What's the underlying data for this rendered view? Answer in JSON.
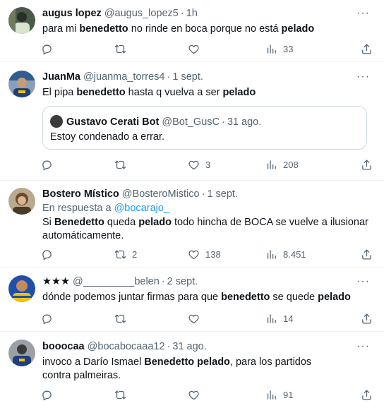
{
  "tweets": [
    {
      "name": "augus lopez",
      "handle": "@augus_lopez5",
      "time": "1h",
      "text_parts": [
        "para mi ",
        "benedetto",
        " no rinde en boca porque no está ",
        "pelado",
        ""
      ],
      "counts": {
        "reply": "",
        "retweet": "",
        "like": "",
        "views": "33"
      }
    },
    {
      "name": "JuanMa",
      "handle": "@juanma_torres4",
      "time": "1 sept.",
      "text_parts": [
        "El pipa ",
        "benedetto",
        " hasta q vuelva a ser ",
        "pelado",
        ""
      ],
      "quote": {
        "name": "Gustavo Cerati Bot",
        "handle": "@Bot_GusC",
        "time": "31 ago.",
        "text": "Estoy condenado a errar."
      },
      "counts": {
        "reply": "",
        "retweet": "",
        "like": "3",
        "views": "208"
      }
    },
    {
      "name": "Bostero Místico",
      "handle": "@BosteroMistico",
      "time": "1 sept.",
      "reply_prefix": "En respuesta a ",
      "reply_handle": "@bocarajo_",
      "text_parts": [
        "Si ",
        "Benedetto",
        " queda ",
        "pelado",
        " todo hincha de BOCA se vuelve a ilusionar automáticamente."
      ],
      "counts": {
        "reply": "",
        "retweet": "2",
        "like": "138",
        "views": "8.451"
      }
    },
    {
      "name": "★★★",
      "handle": "@_________belen",
      "time": "2 sept.",
      "text_parts": [
        "dónde podemos juntar firmas para que ",
        "benedetto",
        " se quede ",
        "pelado",
        ""
      ],
      "counts": {
        "reply": "",
        "retweet": "",
        "like": "",
        "views": "14"
      }
    },
    {
      "name": "booocaa",
      "handle": "@bocabocaaa12",
      "time": "31 ago.",
      "text_parts": [
        "invoco a Darío Ismael ",
        "Benedetto pelado",
        ", para los partidos contra palmeiras.",
        "",
        ""
      ],
      "counts": {
        "reply": "",
        "retweet": "",
        "like": "",
        "views": "91"
      }
    }
  ],
  "icons": {
    "more": "more-dots-icon",
    "reply": "reply-bubble-icon",
    "retweet": "retweet-icon",
    "like": "heart-icon",
    "views": "views-bars-icon",
    "share": "share-icon"
  },
  "colors": {
    "text": "#0f1419",
    "secondary": "#536471",
    "link": "#1d9bf0",
    "border": "#eff3f4"
  }
}
